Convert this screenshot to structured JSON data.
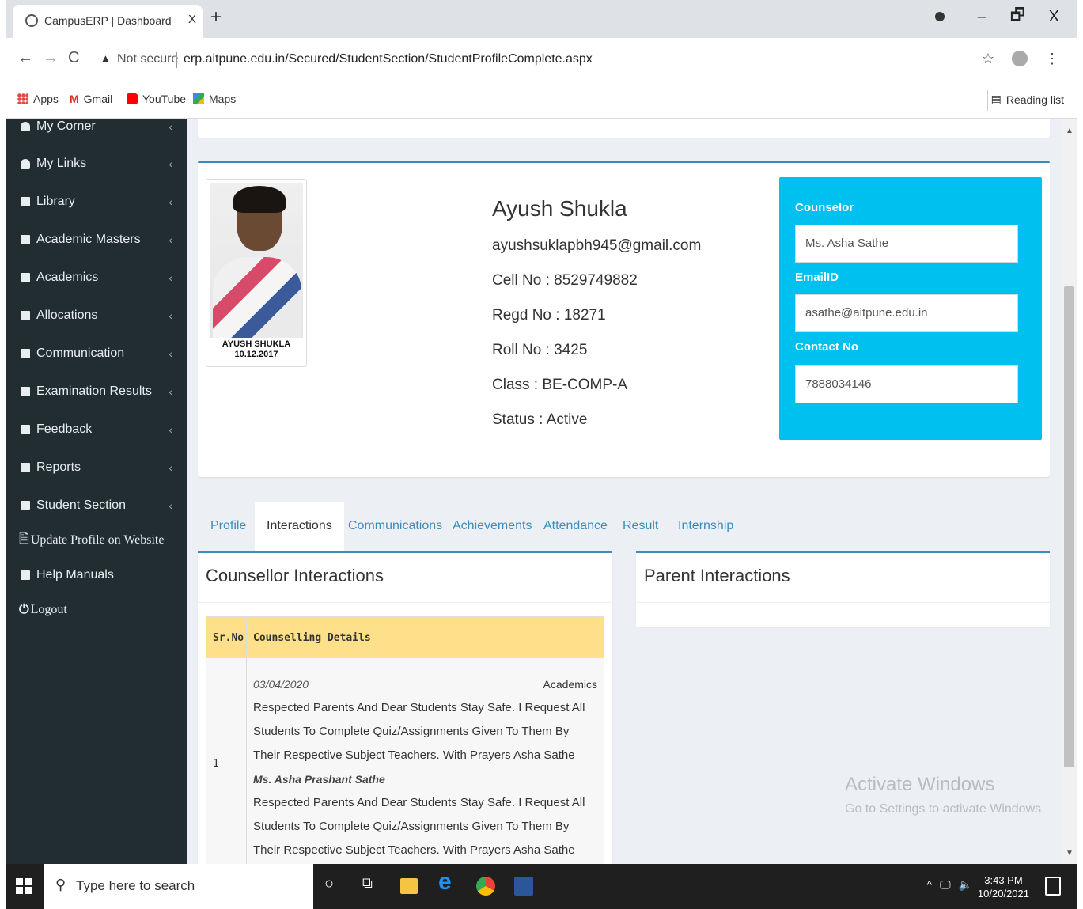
{
  "browser": {
    "tab_title": "CampusERP | Dashboard",
    "tab_close": "X",
    "new_tab": "+",
    "window_controls": [
      "–",
      "🗗",
      "X"
    ],
    "not_secure": "Not secure",
    "url": "erp.aitpune.edu.in/Secured/StudentSection/StudentProfileComplete.aspx",
    "bookmarks": [
      {
        "label": "Apps",
        "icon": "apps-icon",
        "color": "#e8453c"
      },
      {
        "label": "Gmail",
        "icon": "gmail-icon",
        "color": "#d93025"
      },
      {
        "label": "YouTube",
        "icon": "youtube-icon",
        "color": "#ff0000"
      },
      {
        "label": "Maps",
        "icon": "maps-icon",
        "color": "#34a853"
      }
    ],
    "reading_list": "Reading list"
  },
  "sidebar": {
    "items": [
      {
        "label": "My Corner",
        "icon": "user-icon"
      },
      {
        "label": "My Links",
        "icon": "user-icon"
      },
      {
        "label": "Library",
        "icon": "book-icon"
      },
      {
        "label": "Academic Masters",
        "icon": "folder-icon"
      },
      {
        "label": "Academics",
        "icon": "folder-icon"
      },
      {
        "label": "Allocations",
        "icon": "folder-icon"
      },
      {
        "label": "Communication",
        "icon": "folder-icon"
      },
      {
        "label": "Examination Results",
        "icon": "folder-icon"
      },
      {
        "label": "Feedback",
        "icon": "folder-icon"
      },
      {
        "label": "Reports",
        "icon": "folder-icon"
      },
      {
        "label": "Student Section",
        "icon": "folder-icon"
      }
    ],
    "update_profile": "Update Profile on Website",
    "help_manuals": "Help Manuals",
    "logout": "Logout",
    "chevron": "‹"
  },
  "profile": {
    "photo_caption_name": "AYUSH SHUKLA",
    "photo_caption_date": "10.12.2017",
    "name": "Ayush Shukla",
    "email": "ayushsuklapbh945@gmail.com",
    "cell": "Cell No : 8529749882",
    "regd": "Regd No : 18271",
    "roll": "Roll No : 3425",
    "class": "Class : BE-COMP-A",
    "status": "Status : Active"
  },
  "counselor": {
    "label": "Counselor",
    "name": "Ms. Asha Sathe",
    "email_label": "EmailID",
    "email": "asathe@aitpune.edu.in",
    "contact_label": "Contact No",
    "contact": "7888034146"
  },
  "tabs": [
    "Profile",
    "Interactions",
    "Communications",
    "Achievements",
    "Attendance",
    "Result",
    "Internship"
  ],
  "counsellor_interactions": {
    "title": "Counsellor Interactions",
    "col_srno": "Sr.No",
    "col_details": "Counselling Details",
    "rows": [
      {
        "srno": "1",
        "date": "03/04/2020",
        "category": "Academics",
        "text": "Respected Parents And Dear Students Stay Safe. I Request All Students To Complete Quiz/Assignments Given To Them By Their Respective Subject Teachers. With Prayers Asha Sathe",
        "by": "Ms. Asha Prashant Sathe",
        "text2": "Respected Parents And Dear Students Stay Safe. I Request All Students To Complete Quiz/Assignments Given To Them By Their Respective Subject Teachers. With Prayers Asha Sathe"
      }
    ]
  },
  "parent_interactions": {
    "title": "Parent Interactions"
  },
  "watermark": {
    "line1": "Activate Windows",
    "line2": "Go to Settings to activate Windows."
  },
  "taskbar": {
    "search_placeholder": "Type here to search",
    "time": "3:43 PM",
    "date": "10/20/2021"
  }
}
